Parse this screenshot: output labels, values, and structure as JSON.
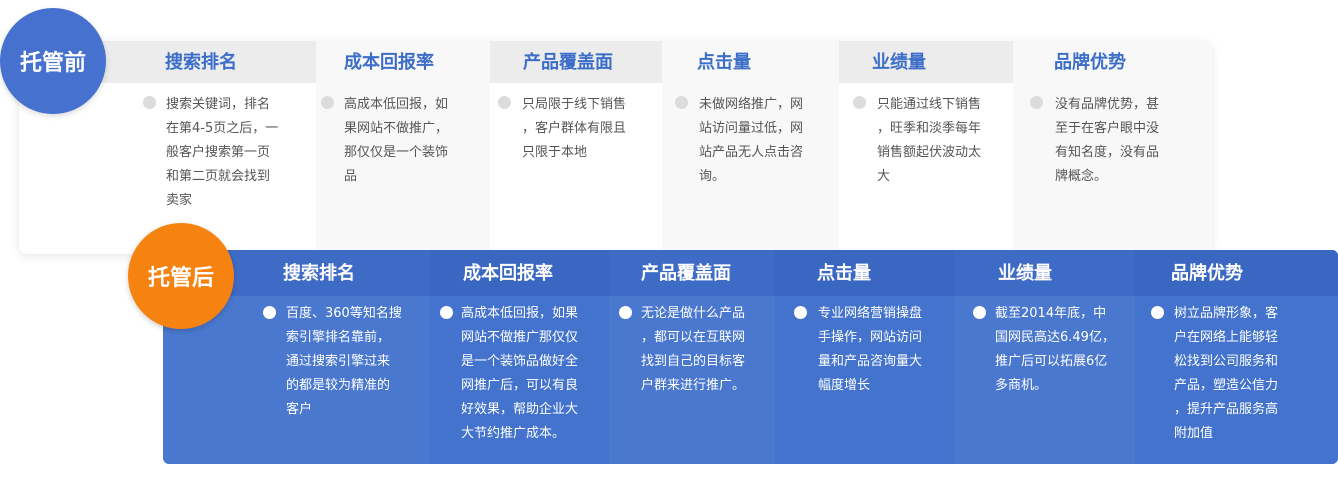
{
  "before": {
    "badge": "托管前",
    "columns": [
      {
        "title": "搜索排名",
        "body": "搜索关键词，排名\n在第4-5页之后，一\n般客户搜索第一页\n和第二页就会找到\n卖家"
      },
      {
        "title": "成本回报率",
        "body": "高成本低回报，如\n果网站不做推广，\n那仅仅是一个装饰\n品"
      },
      {
        "title": "产品覆盖面",
        "body": "只局限于线下销售\n，客户群体有限且\n只限于本地"
      },
      {
        "title": "点击量",
        "body": "未做网络推广，网\n站访问量过低，网\n站产品无人点击咨\n询。"
      },
      {
        "title": "业绩量",
        "body": "只能通过线下销售\n，旺季和淡季每年\n销售额起伏波动太\n大"
      },
      {
        "title": "品牌优势",
        "body": "没有品牌优势，甚\n至于在客户眼中没\n有知名度，没有品\n牌概念。"
      }
    ]
  },
  "after": {
    "badge": "托管后",
    "columns": [
      {
        "title": "搜索排名",
        "body": "百度、360等知名搜\n索引擎排名靠前，\n通过搜索引擎过来\n的都是较为精准的\n客户"
      },
      {
        "title": "成本回报率",
        "body": "高成本低回报，如果\n网站不做推广那仅仅\n是一个装饰品做好全\n网推广后，可以有良\n好效果，帮助企业大\n大节约推广成本。"
      },
      {
        "title": "产品覆盖面",
        "body": "无论是做什么产品\n，都可以在互联网\n找到自己的目标客\n户群来进行推广。"
      },
      {
        "title": "点击量",
        "body": "专业网络营销操盘\n手操作，网站访问\n量和产品咨询量大\n幅度增长"
      },
      {
        "title": "业绩量",
        "body": "截至2014年底，中\n国网民高达6.49亿，\n推广后可以拓展6亿\n多商机。"
      },
      {
        "title": "品牌优势",
        "body": "树立品牌形象，客\n户在网络上能够轻\n松找到公司服务和\n产品，塑造公信力\n，提升产品服务高\n附加值"
      }
    ]
  }
}
